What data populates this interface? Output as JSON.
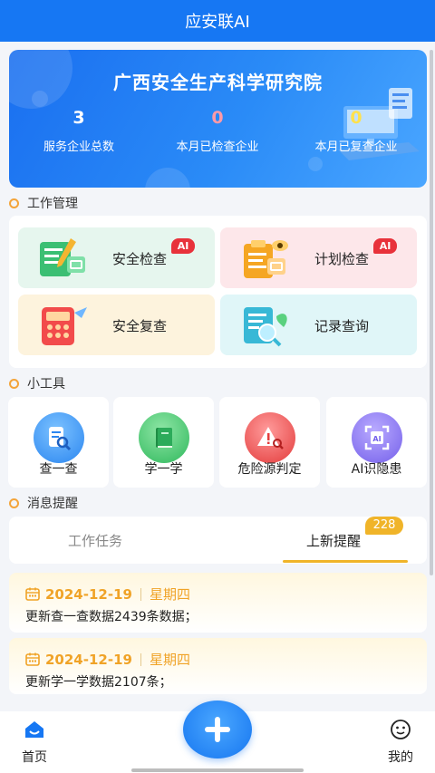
{
  "header": {
    "title": "应安联AI"
  },
  "banner": {
    "title": "广西安全生产科学研究院",
    "stats": [
      {
        "value": "3",
        "label": "服务企业总数",
        "color": "#ffffff"
      },
      {
        "value": "0",
        "label": "本月已检查企业",
        "color": "#ff9aa8"
      },
      {
        "value": "0",
        "label": "本月已复查企业",
        "color": "#ffe14d"
      }
    ]
  },
  "work": {
    "section_title": "工作管理",
    "cards": [
      {
        "label": "安全检查",
        "badge": "AI",
        "bg": "#e6f6ee",
        "icon": "checklist-pencil-icon"
      },
      {
        "label": "计划检查",
        "badge": "AI",
        "bg": "#fde7ea",
        "icon": "plan-clipboard-icon"
      },
      {
        "label": "安全复查",
        "badge": "",
        "bg": "#fdf3dd",
        "icon": "calculator-review-icon"
      },
      {
        "label": "记录查询",
        "badge": "",
        "bg": "#e0f6f8",
        "icon": "record-search-icon"
      }
    ]
  },
  "tools": {
    "section_title": "小工具",
    "items": [
      {
        "label": "查一查",
        "icon": "document-search-icon",
        "color": "#2b86f0"
      },
      {
        "label": "学一学",
        "icon": "book-icon",
        "color": "#36c26a"
      },
      {
        "label": "危险源判定",
        "icon": "warning-search-icon",
        "color": "#ec4b4b"
      },
      {
        "label": "AI识隐患",
        "icon": "ai-scan-icon",
        "color": "#7f6cf0"
      }
    ]
  },
  "messages": {
    "section_title": "消息提醒",
    "tabs": [
      {
        "label": "工作任务"
      },
      {
        "label": "上新提醒",
        "badge": "228"
      }
    ],
    "items": [
      {
        "date": "2024-12-19",
        "weekday": "星期四",
        "text": "更新查一查数据2439条数据；"
      },
      {
        "date": "2024-12-19",
        "weekday": "星期四",
        "text": "更新学一学数据2107条；"
      }
    ]
  },
  "bottom_nav": {
    "home_label": "首页",
    "mine_label": "我的",
    "accent": "#1677f3"
  }
}
